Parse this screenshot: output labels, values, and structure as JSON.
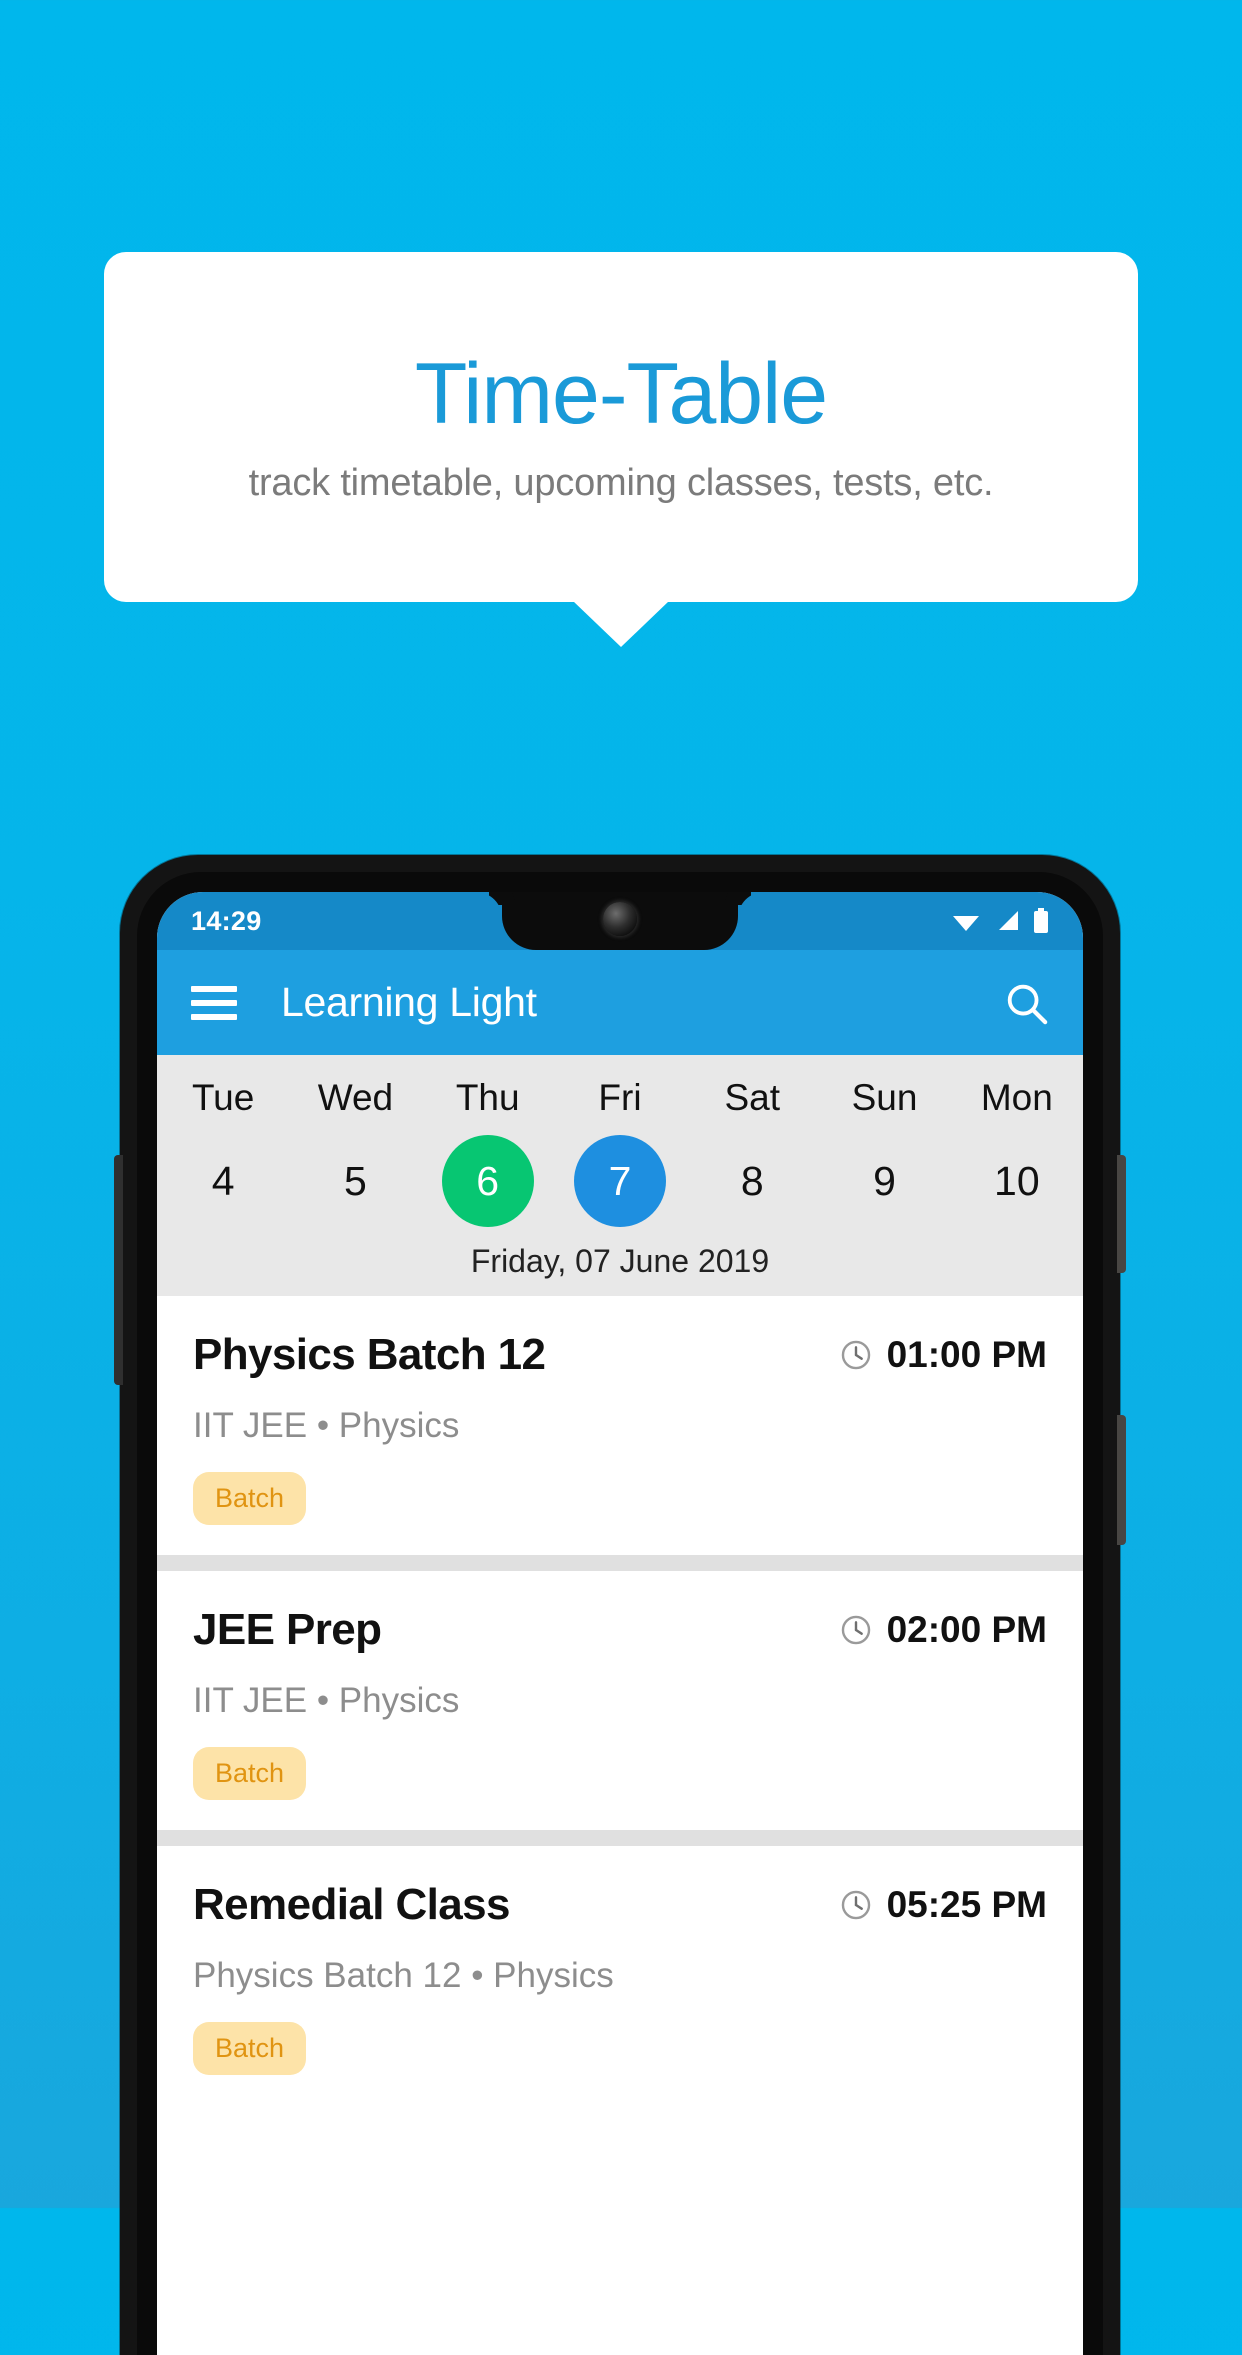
{
  "promo": {
    "title": "Time-Table",
    "subtitle": "track timetable, upcoming classes, tests, etc.",
    "title_color": "#1a9ad8",
    "subtitle_color": "#7b7b7b",
    "background_color": "#00b7ec"
  },
  "phone": {
    "status_bar": {
      "time": "14:29",
      "icons": [
        "wifi-icon",
        "signal-icon",
        "battery-icon"
      ],
      "background_color": "#1589c8"
    },
    "app_bar": {
      "menu_icon": "hamburger-menu-icon",
      "title": "Learning Light",
      "search_icon": "search-icon",
      "background_color": "#1e9fe0"
    },
    "date_strip": {
      "background_color": "#e8e8e8",
      "days": [
        {
          "day": "Tue",
          "date": "4",
          "state": "normal"
        },
        {
          "day": "Wed",
          "date": "5",
          "state": "normal"
        },
        {
          "day": "Thu",
          "date": "6",
          "state": "today"
        },
        {
          "day": "Fri",
          "date": "7",
          "state": "selected"
        },
        {
          "day": "Sat",
          "date": "8",
          "state": "normal"
        },
        {
          "day": "Sun",
          "date": "9",
          "state": "normal"
        },
        {
          "day": "Mon",
          "date": "10",
          "state": "normal"
        }
      ],
      "today_color": "#07c672",
      "selected_color": "#1e8fe0",
      "selected_date_label": "Friday, 07 June 2019"
    },
    "schedule": [
      {
        "title": "Physics Batch 12",
        "time": "01:00 PM",
        "time_icon": "clock-icon",
        "subtitle": "IIT JEE • Physics",
        "tag": "Batch"
      },
      {
        "title": "JEE Prep",
        "time": "02:00 PM",
        "time_icon": "clock-icon",
        "subtitle": "IIT JEE • Physics",
        "tag": "Batch"
      },
      {
        "title": "Remedial Class",
        "time": "05:25 PM",
        "time_icon": "clock-icon",
        "subtitle": "Physics Batch 12 • Physics",
        "tag": "Batch"
      }
    ],
    "tag_background_color": "#fde3a8",
    "tag_text_color": "#e09412"
  }
}
